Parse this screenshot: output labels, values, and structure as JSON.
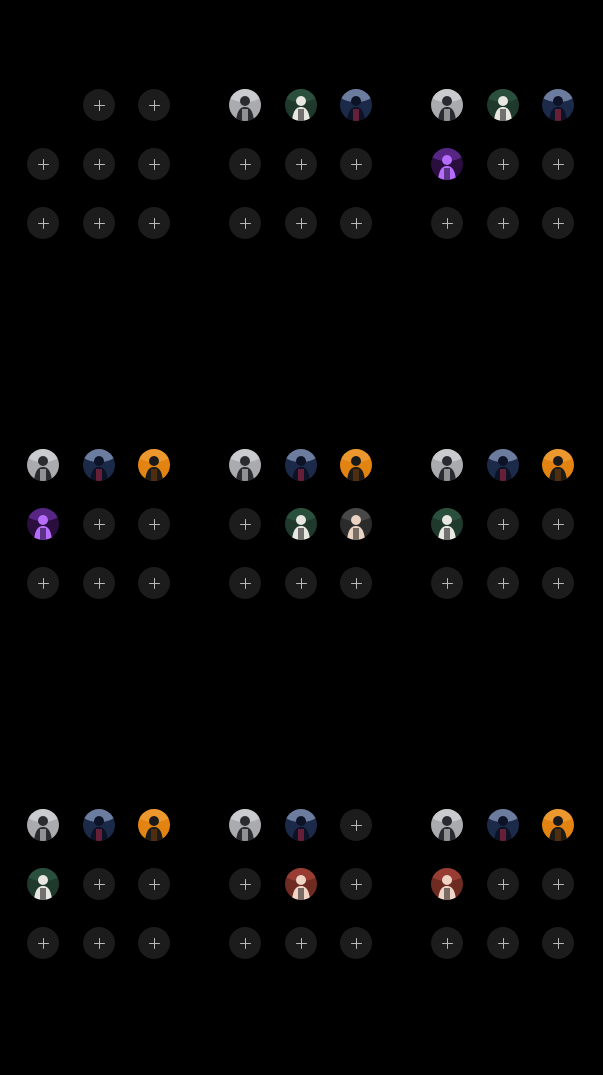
{
  "screen": {
    "background": "#000000",
    "add_icon": "plus-icon"
  },
  "avatar_styles": {
    "gray": {
      "bg": "#a9abaf",
      "top": "#d8d9db",
      "figure": "#2a2b30",
      "accent": "#e6e6e6"
    },
    "green": {
      "bg": "#1f3a2d",
      "top": "#2f5a45",
      "figure": "#e9e7e2",
      "accent": "#111111"
    },
    "navy": {
      "bg": "#1c2a4a",
      "top": "#8fa0c2",
      "figure": "#0d1326",
      "accent": "#b02a45"
    },
    "orange": {
      "bg": "#e38412",
      "top": "#f1a13a",
      "figure": "#1a1a1a",
      "accent": "#7a3f05"
    },
    "purple": {
      "bg": "#2a0e3e",
      "top": "#6b2fa3",
      "figure": "#b56cff",
      "accent": "#12061f"
    },
    "portrait": {
      "bg": "#2b2b2b",
      "top": "#555555",
      "figure": "#e9d2c2",
      "accent": "#1a1a1a"
    },
    "red": {
      "bg": "#6e2b22",
      "top": "#a8463a",
      "figure": "#f0d5c6",
      "accent": "#161616"
    }
  },
  "panels": [
    {
      "slots": [
        "empty",
        "add",
        "add",
        "add",
        "add",
        "add",
        "add",
        "add",
        "add"
      ]
    },
    {
      "slots": [
        "gray",
        "green",
        "navy",
        "add",
        "add",
        "add",
        "add",
        "add",
        "add"
      ]
    },
    {
      "slots": [
        "gray",
        "green",
        "navy",
        "purple",
        "add",
        "add",
        "add",
        "add",
        "add"
      ]
    },
    {
      "slots": [
        "gray",
        "navy",
        "orange",
        "purple",
        "add",
        "add",
        "add",
        "add",
        "add"
      ]
    },
    {
      "slots": [
        "gray",
        "navy",
        "orange",
        "add",
        "green",
        "portrait",
        "add",
        "add",
        "add"
      ]
    },
    {
      "slots": [
        "gray",
        "navy",
        "orange",
        "green",
        "add",
        "add",
        "add",
        "add",
        "add"
      ]
    },
    {
      "slots": [
        "gray",
        "navy",
        "orange",
        "green",
        "add",
        "add",
        "add",
        "add",
        "add"
      ]
    },
    {
      "slots": [
        "gray",
        "navy",
        "add",
        "add",
        "red",
        "add",
        "add",
        "add",
        "add"
      ]
    },
    {
      "slots": [
        "gray",
        "navy",
        "orange",
        "red",
        "add",
        "add",
        "add",
        "add",
        "add"
      ]
    }
  ]
}
